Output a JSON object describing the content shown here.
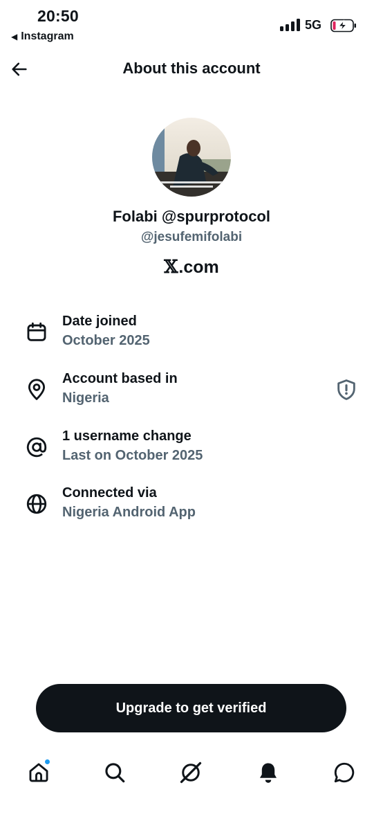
{
  "status_bar": {
    "time": "20:50",
    "back_app": "Instagram",
    "network": "5G"
  },
  "header": {
    "title": "About this account"
  },
  "profile": {
    "display_name": "Folabi @spurprotocol",
    "handle": "@jesufemifolabi",
    "site": ".com"
  },
  "info": [
    {
      "label": "Date joined",
      "value": "October 2025",
      "icon": "calendar-icon"
    },
    {
      "label": "Account based in",
      "value": "Nigeria",
      "icon": "location-pin-icon"
    },
    {
      "label": "1 username change",
      "value": "Last on October 2025",
      "icon": "at-sign-icon"
    },
    {
      "label": "Connected via",
      "value": "Nigeria Android App",
      "icon": "globe-icon"
    }
  ],
  "upgrade": {
    "label": "Upgrade to get verified"
  },
  "nav": [
    "home-icon",
    "search-icon",
    "grok-icon",
    "notifications-bell-icon",
    "messages-icon"
  ],
  "colors": {
    "text": "#0f1419",
    "secondary": "#536471",
    "button_bg": "#0f1419",
    "notification_dot": "#1d9bf0",
    "battery_low": "#e0245e"
  }
}
